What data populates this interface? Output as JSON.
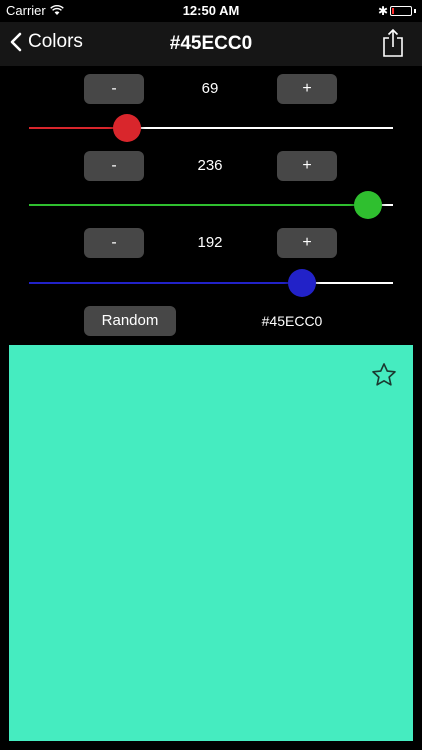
{
  "status_bar": {
    "carrier": "Carrier",
    "time": "12:50 AM"
  },
  "nav": {
    "back_label": "Colors",
    "title": "#45ECC0"
  },
  "channels": [
    {
      "value": "69",
      "fraction": 0.27,
      "color": "#d9262c",
      "minus": "-",
      "plus": "+"
    },
    {
      "value": "236",
      "fraction": 0.93,
      "color": "#2fbf2f",
      "minus": "-",
      "plus": "+"
    },
    {
      "value": "192",
      "fraction": 0.75,
      "color": "#2222c8",
      "minus": "-",
      "plus": "+"
    }
  ],
  "random_label": "Random",
  "hex_value": "#45ECC0",
  "swatch_color": "#45ECC0"
}
